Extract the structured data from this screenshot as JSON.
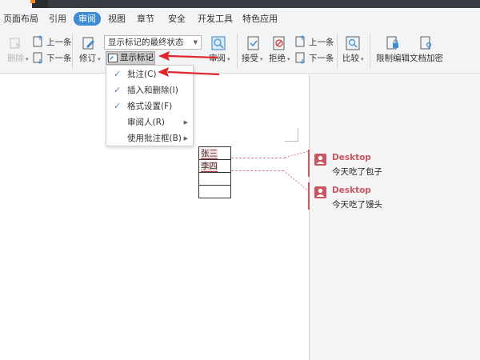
{
  "menu": {
    "items": [
      "页面布局",
      "引用",
      "审阅",
      "视图",
      "章节",
      "安全",
      "开发工具",
      "特色应用"
    ],
    "active": "审阅"
  },
  "ribbon": {
    "delete_label": "删除",
    "prev_label": "上一条",
    "next_label": "下一条",
    "revise_label": "修订",
    "display_state": "显示标记的最终状态",
    "show_marks_label": "显示标记",
    "review_label": "审阅",
    "accept_label": "接受",
    "reject_label": "拒绝",
    "prev2_label": "上一条",
    "next2_label": "下一条",
    "compare_label": "比较",
    "restrict_label": "限制编辑",
    "encrypt_label": "文档加密"
  },
  "dropdown": {
    "items": [
      {
        "label": "批注(C)",
        "checked": true,
        "submenu": false
      },
      {
        "label": "插入和删除(I)",
        "checked": true,
        "submenu": false
      },
      {
        "label": "格式设置(F)",
        "checked": true,
        "submenu": false
      },
      {
        "label": "审阅人(R)",
        "checked": false,
        "submenu": true
      },
      {
        "label": "使用批注框(B)",
        "checked": false,
        "submenu": true
      }
    ]
  },
  "document": {
    "table_rows": [
      "张三",
      "李四",
      "",
      ""
    ]
  },
  "comments": [
    {
      "author": "Desktop",
      "text": "今天吃了包子"
    },
    {
      "author": "Desktop",
      "text": "今天吃了馒头"
    }
  ],
  "colors": {
    "accent": "#3e8bd6",
    "comment": "#c95663",
    "arrow": "#e0262c"
  },
  "icons": [
    "delete-icon",
    "prev-icon",
    "next-icon",
    "revise-icon",
    "show-marks-icon",
    "review-icon",
    "accept-icon",
    "reject-icon",
    "prev2-icon",
    "next2-icon",
    "compare-icon",
    "restrict-icon",
    "encrypt-icon",
    "check-icon",
    "user-icon"
  ]
}
